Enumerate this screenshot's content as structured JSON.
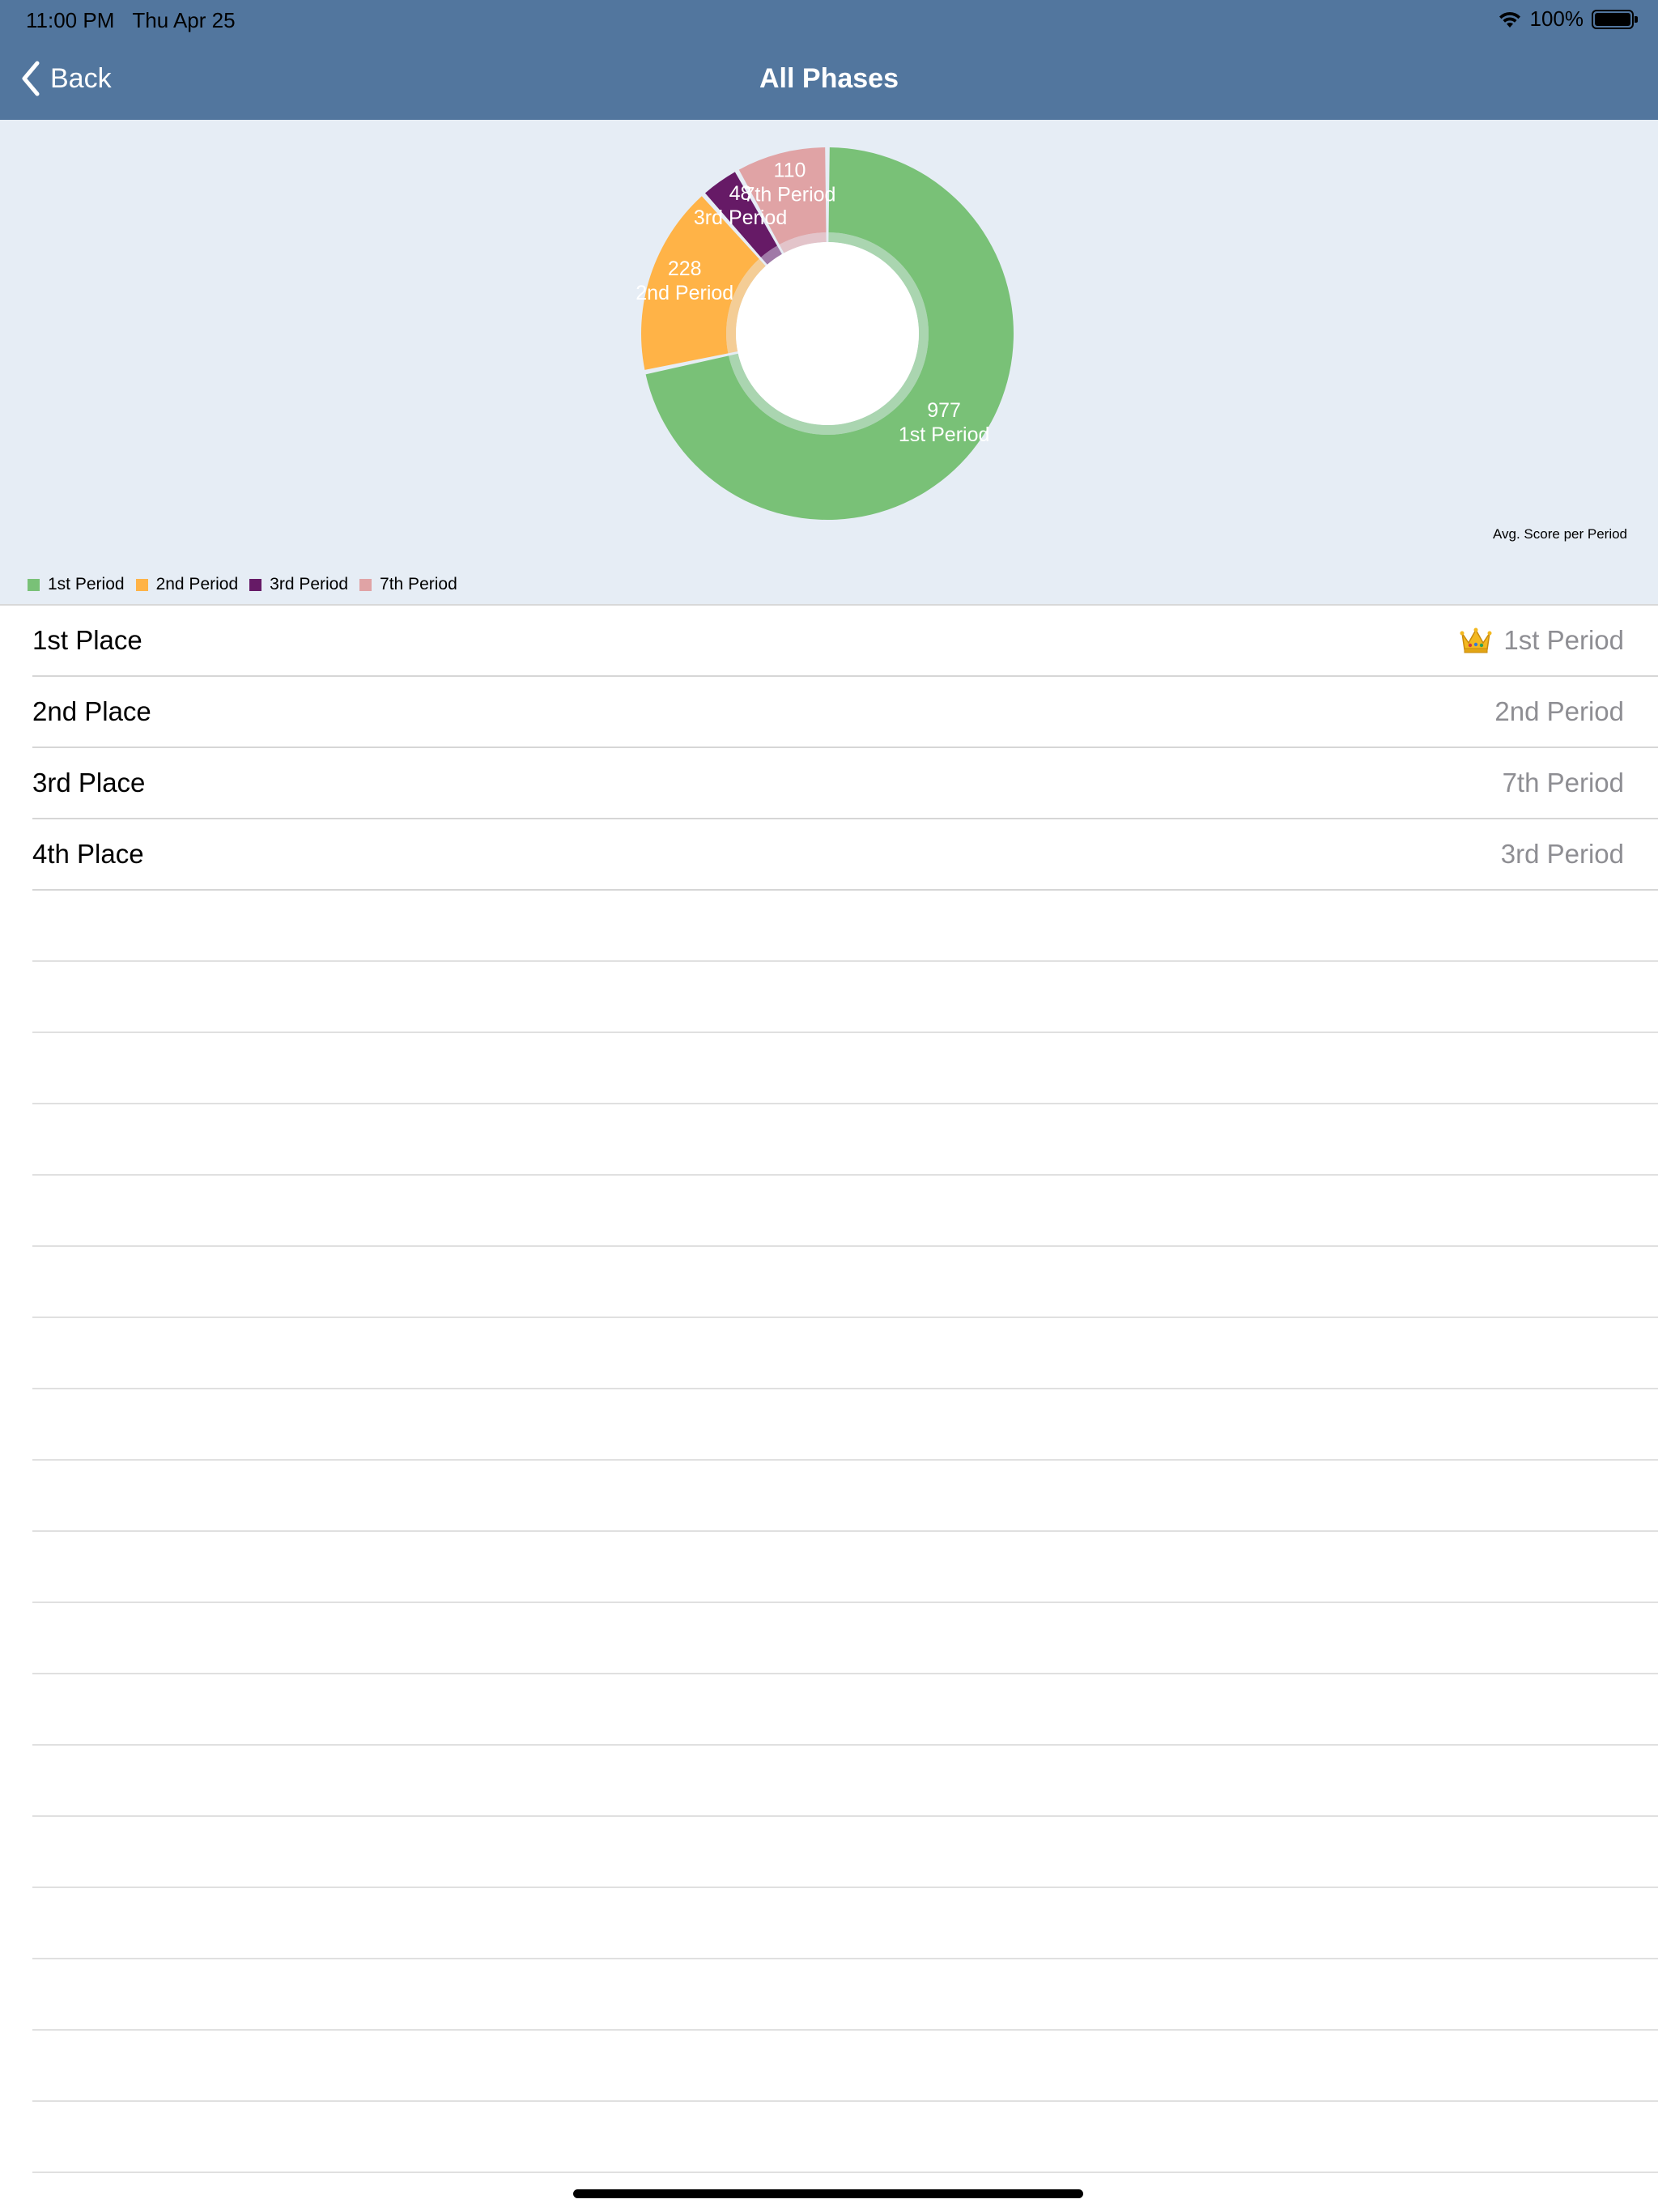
{
  "status_bar": {
    "time": "11:00 PM",
    "date": "Thu Apr 25",
    "battery_percent": "100%",
    "battery_level": 1.0,
    "icons": [
      "wifi-icon",
      "battery-icon"
    ]
  },
  "navbar": {
    "back_label": "Back",
    "title": "All Phases",
    "color": "#52769e"
  },
  "chart_data": {
    "type": "pie",
    "variant": "donut",
    "description": "Avg. Score per Period",
    "legend_position": "bottom-left",
    "slices": [
      {
        "label": "1st Period",
        "value": 977,
        "color": "#79c177"
      },
      {
        "label": "2nd Period",
        "value": 228,
        "color": "#ffb347"
      },
      {
        "label": "3rd Period",
        "value": 48,
        "color": "#661a66"
      },
      {
        "label": "7th Period",
        "value": 110,
        "color": "#e0a3a5"
      }
    ]
  },
  "table": {
    "rows": [
      {
        "title": "1st Place",
        "detail": "1st Period",
        "icon": "crown-icon"
      },
      {
        "title": "2nd Place",
        "detail": "2nd Period"
      },
      {
        "title": "3rd Place",
        "detail": "7th Period"
      },
      {
        "title": "4th Place",
        "detail": "3rd Period"
      }
    ]
  }
}
